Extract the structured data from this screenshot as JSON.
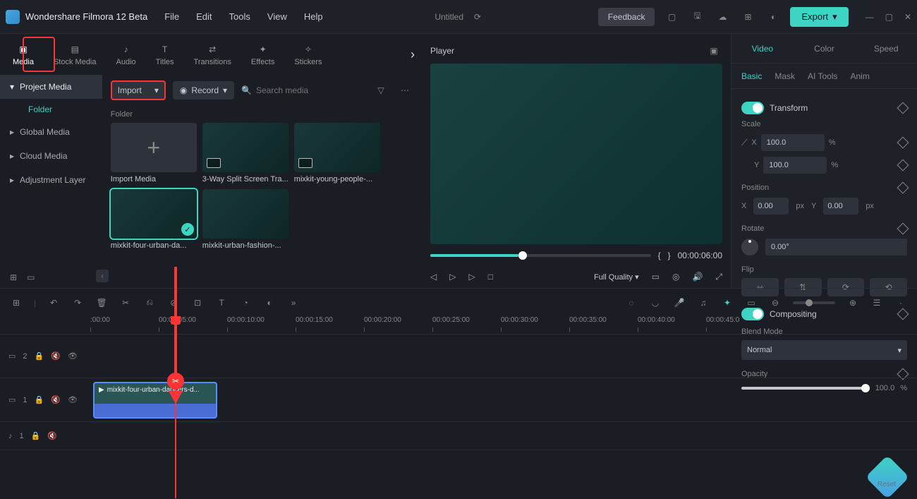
{
  "app": {
    "title": "Wondershare Filmora 12 Beta",
    "document": "Untitled"
  },
  "menu": {
    "file": "File",
    "edit": "Edit",
    "tools": "Tools",
    "view": "View",
    "help": "Help"
  },
  "header": {
    "feedback": "Feedback",
    "export": "Export"
  },
  "nav": {
    "media": "Media",
    "stock": "Stock Media",
    "audio": "Audio",
    "titles": "Titles",
    "transitions": "Transitions",
    "effects": "Effects",
    "stickers": "Stickers"
  },
  "sidebar": {
    "project": "Project Media",
    "folder": "Folder",
    "global": "Global Media",
    "cloud": "Cloud Media",
    "adjustment": "Adjustment Layer"
  },
  "mediaToolbar": {
    "import": "Import",
    "record": "Record",
    "search_ph": "Search media",
    "folder_label": "Folder"
  },
  "thumbs": {
    "import": "Import Media",
    "t1": "3-Way Split Screen Tra...",
    "t2": "mixkit-young-people-...",
    "t3": "mixkit-four-urban-da...",
    "t4": "mixkit-urban-fashion-..."
  },
  "player": {
    "title": "Player",
    "time": "00:00:06:00",
    "quality": "Full Quality",
    "brace_l": "{",
    "brace_r": "}"
  },
  "rightPanel": {
    "tabs": {
      "video": "Video",
      "color": "Color",
      "speed": "Speed"
    },
    "subtabs": {
      "basic": "Basic",
      "mask": "Mask",
      "ai": "AI Tools",
      "anim": "Anim"
    },
    "transform": "Transform",
    "scale": "Scale",
    "scale_x": "X",
    "scale_x_val": "100.0",
    "scale_y": "Y",
    "scale_y_val": "100.0",
    "pct": "%",
    "position": "Position",
    "pos_x": "X",
    "pos_x_val": "0.00",
    "pos_y": "Y",
    "pos_y_val": "0.00",
    "px": "px",
    "rotate": "Rotate",
    "rotate_val": "0.00°",
    "flip": "Flip",
    "compositing": "Compositing",
    "blend": "Blend Mode",
    "blend_val": "Normal",
    "opacity": "Opacity",
    "opacity_val": "100.0",
    "reset": "Reset"
  },
  "timeline": {
    "ticks": [
      ":00:00",
      "00:00:05:00",
      "00:00:10:00",
      "00:00:15:00",
      "00:00:20:00",
      "00:00:25:00",
      "00:00:30:00",
      "00:00:35:00",
      "00:00:40:00",
      "00:00:45:0"
    ],
    "track2": "2",
    "track1": "1",
    "audio1": "1",
    "clip": "mixkit-four-urban-dancers-d..."
  }
}
